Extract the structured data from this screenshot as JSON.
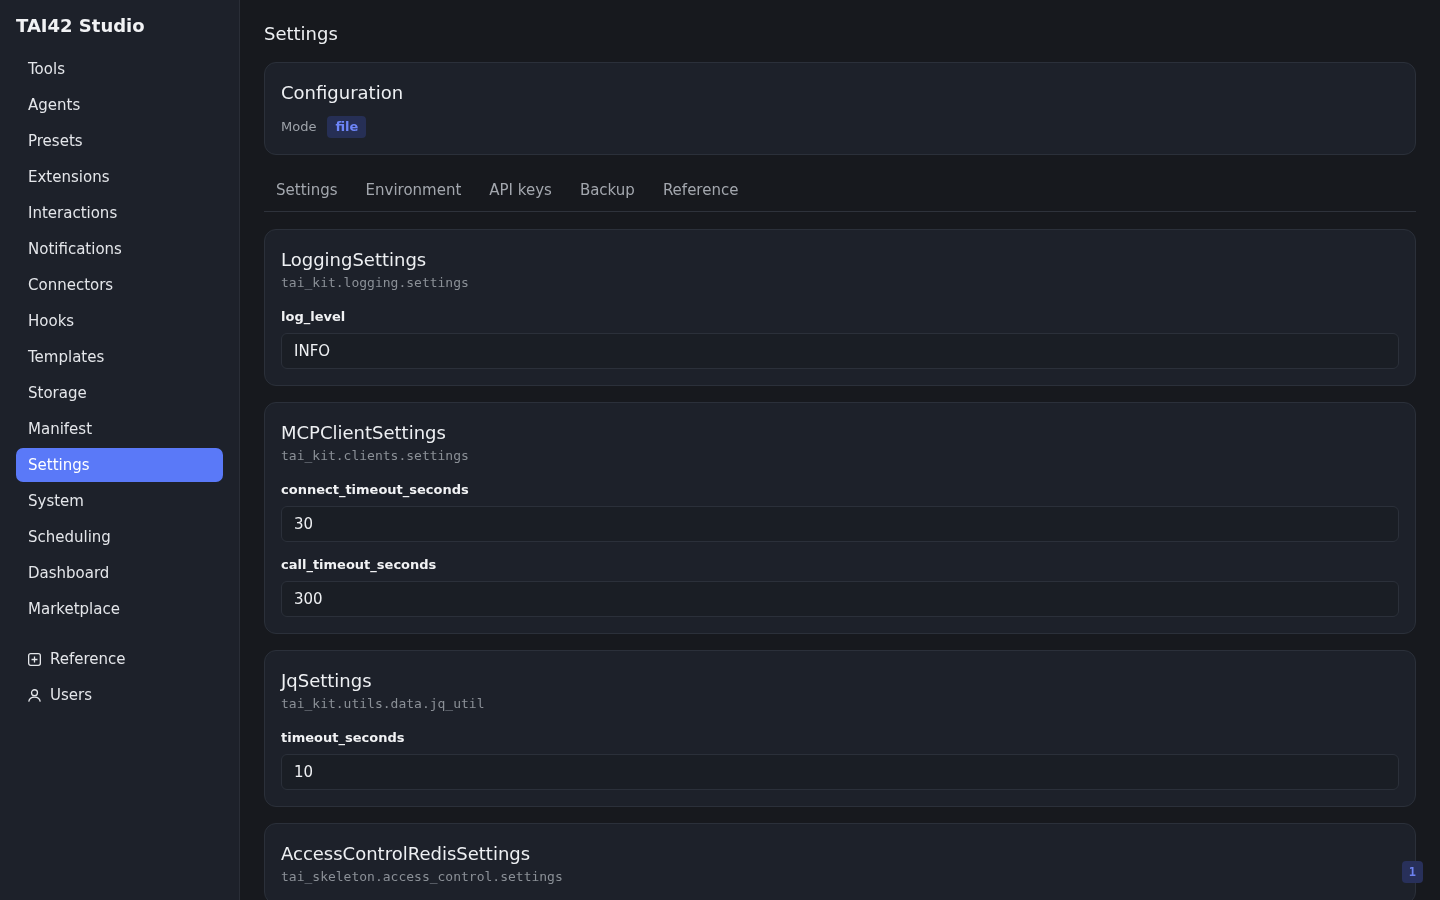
{
  "sidebar": {
    "brand": "TAI42 Studio",
    "items": [
      {
        "label": "Tools",
        "selected": false
      },
      {
        "label": "Agents",
        "selected": false
      },
      {
        "label": "Presets",
        "selected": false
      },
      {
        "label": "Extensions",
        "selected": false
      },
      {
        "label": "Interactions",
        "selected": false
      },
      {
        "label": "Notifications",
        "selected": false
      },
      {
        "label": "Connectors",
        "selected": false
      },
      {
        "label": "Hooks",
        "selected": false
      },
      {
        "label": "Templates",
        "selected": false
      },
      {
        "label": "Storage",
        "selected": false
      },
      {
        "label": "Manifest",
        "selected": false
      },
      {
        "label": "Settings",
        "selected": true
      },
      {
        "label": "System",
        "selected": false
      },
      {
        "label": "Scheduling",
        "selected": false
      },
      {
        "label": "Dashboard",
        "selected": false
      },
      {
        "label": "Marketplace",
        "selected": false
      }
    ],
    "footer_items": [
      {
        "label": "Reference",
        "selected": false
      },
      {
        "label": "Users",
        "selected": false
      }
    ]
  },
  "main": {
    "title": "Settings",
    "configuration": {
      "title": "Configuration",
      "mode_label": "Mode",
      "mode_value": "file"
    },
    "tabs": [
      {
        "label": "Settings",
        "selected": false
      },
      {
        "label": "Environment",
        "selected": false
      },
      {
        "label": "API keys",
        "selected": false
      },
      {
        "label": "Backup",
        "selected": false
      },
      {
        "label": "Reference",
        "selected": false
      }
    ],
    "sections": [
      {
        "title": "LoggingSettings",
        "module": "tai_kit.logging.settings",
        "fields": [
          {
            "label": "log_level",
            "value": "INFO"
          }
        ]
      },
      {
        "title": "MCPClientSettings",
        "module": "tai_kit.clients.settings",
        "fields": [
          {
            "label": "connect_timeout_seconds",
            "value": "30"
          },
          {
            "label": "call_timeout_seconds",
            "value": "300"
          }
        ]
      },
      {
        "title": "JqSettings",
        "module": "tai_kit.utils.data.jq_util",
        "fields": [
          {
            "label": "timeout_seconds",
            "value": "10"
          }
        ]
      },
      {
        "title": "AccessControlRedisSettings",
        "module": "tai_skeleton.access_control.settings"
      }
    ]
  },
  "corner_badge": "1"
}
